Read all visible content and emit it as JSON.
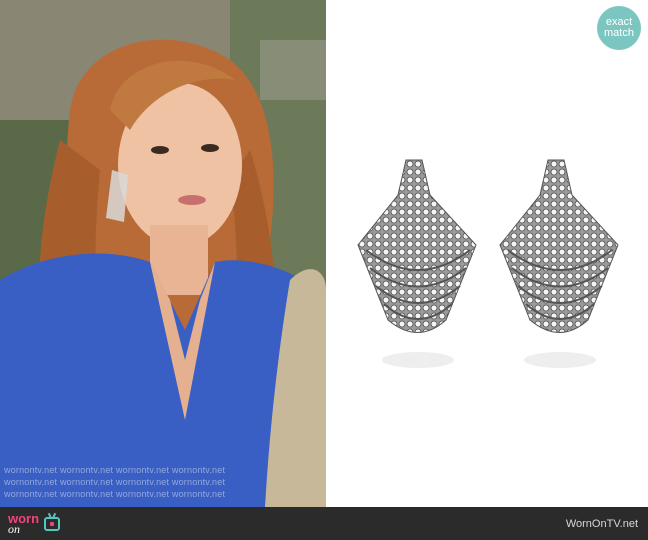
{
  "badge": {
    "line1": "exact",
    "line2": "match"
  },
  "watermark": {
    "rows": [
      "wornontv.net   wornontv.net   wornontv.net   wornontv.net",
      "wornontv.net   wornontv.net   wornontv.net   wornontv.net",
      "wornontv.net   wornontv.net   wornontv.net   wornontv.net"
    ]
  },
  "footer": {
    "logo_worn": "worn",
    "logo_on": "on",
    "site_name": "WornOnTV.net"
  },
  "colors": {
    "badge": "#7cc6c2",
    "footer_bg": "#2b2b2b",
    "logo_pink": "#f0447a",
    "logo_teal": "#52c7c0",
    "blouse": "#3a5fc4",
    "hair": "#b86b36"
  }
}
